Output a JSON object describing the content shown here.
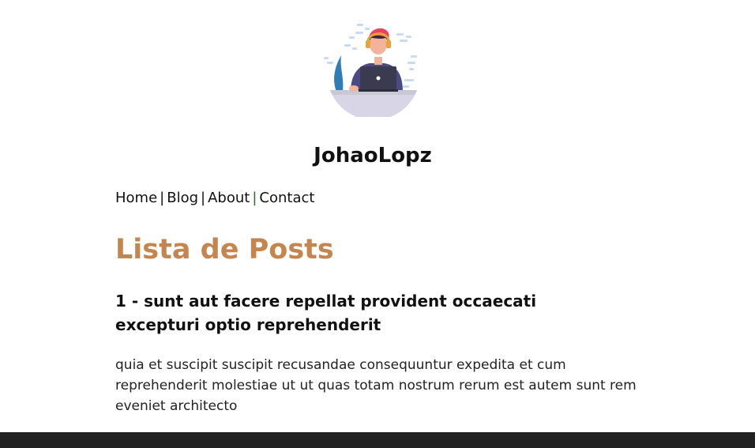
{
  "site": {
    "title": "JohaoLopz"
  },
  "nav": {
    "items": [
      {
        "label": "Home"
      },
      {
        "label": "Blog"
      },
      {
        "label": "About"
      },
      {
        "label": "Contact"
      }
    ],
    "separator": "|"
  },
  "main": {
    "heading": "Lista de Posts",
    "posts": [
      {
        "title": "1 - sunt aut facere repellat provident occaecati excepturi optio reprehenderit",
        "body": "quia et suscipit suscipit recusandae consequuntur expedita et cum reprehenderit molestiae ut ut quas totam nostrum rerum est autem sunt rem eveniet architecto"
      }
    ]
  },
  "colors": {
    "heading_accent": "#c4864e",
    "footer_bar": "#222222",
    "background": "#ffffff"
  },
  "icons": {
    "avatar": "developer-avatar-illustration"
  }
}
